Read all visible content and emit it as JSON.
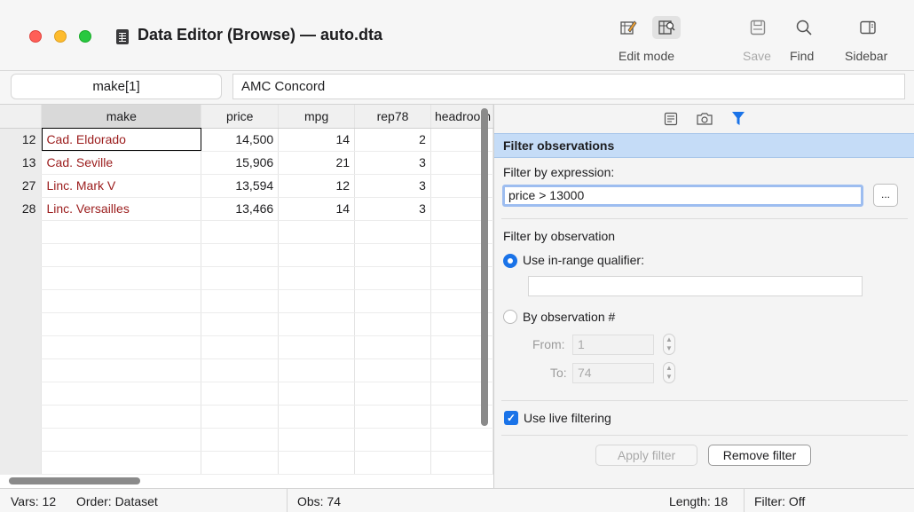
{
  "window": {
    "title": "Data Editor (Browse) — auto.dta"
  },
  "toolbar": {
    "edit_mode_label": "Edit mode",
    "save_label": "Save",
    "find_label": "Find",
    "sidebar_label": "Sidebar"
  },
  "varbar": {
    "cell_name": "make[1]",
    "cell_value": "AMC Concord"
  },
  "grid": {
    "columns": [
      "make",
      "price",
      "mpg",
      "rep78",
      "headroom"
    ],
    "rows": [
      {
        "obs": "12",
        "make": "Cad. Eldorado",
        "price": "14,500",
        "mpg": "14",
        "rep78": "2"
      },
      {
        "obs": "13",
        "make": "Cad. Seville",
        "price": "15,906",
        "mpg": "21",
        "rep78": "3"
      },
      {
        "obs": "27",
        "make": "Linc. Mark V",
        "price": "13,594",
        "mpg": "12",
        "rep78": "3"
      },
      {
        "obs": "28",
        "make": "Linc. Versailles",
        "price": "13,466",
        "mpg": "14",
        "rep78": "3"
      }
    ]
  },
  "sidebar": {
    "section_title": "Filter observations",
    "filter_expr_label": "Filter by expression:",
    "filter_expr_value": "price > 13000",
    "ellipsis_label": "...",
    "filter_obs_label": "Filter by observation",
    "in_range_label": "Use in-range qualifier:",
    "in_range_value": "",
    "by_obs_label": "By observation #",
    "from_label": "From:",
    "from_value": "1",
    "to_label": "To:",
    "to_value": "74",
    "live_filter_label": "Use live filtering",
    "apply_label": "Apply filter",
    "remove_label": "Remove filter"
  },
  "status": {
    "vars": "Vars: 12",
    "order": "Order: Dataset",
    "obs": "Obs: 74",
    "length": "Length: 18",
    "filter": "Filter: Off"
  },
  "colors": {
    "accent": "#1a73e8",
    "string_text": "#9b1c1c",
    "section_header_bg": "#c5dcf7"
  }
}
